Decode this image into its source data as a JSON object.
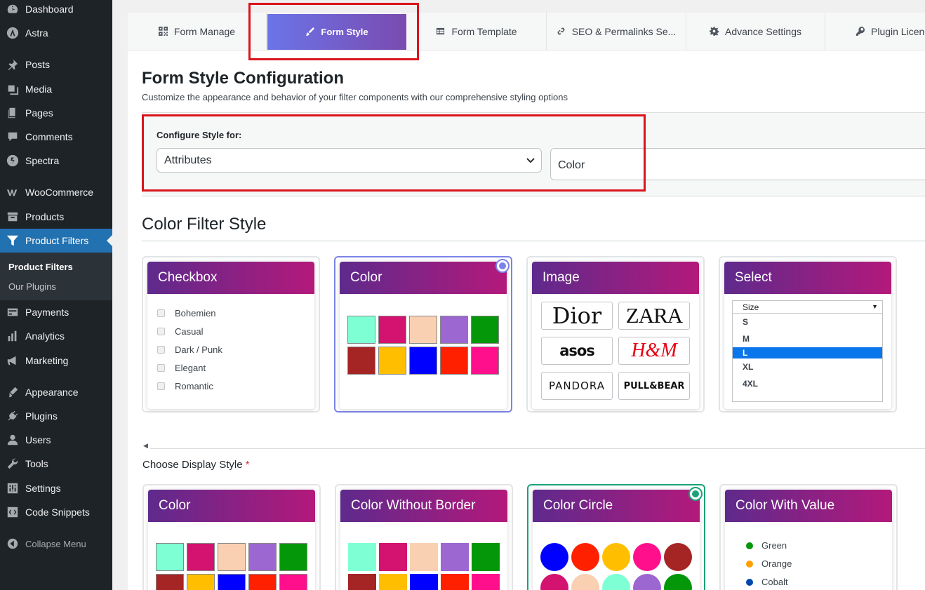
{
  "sidebar": {
    "items": [
      {
        "label": "Dashboard",
        "icon": "dashboard-icon"
      },
      {
        "label": "Astra",
        "icon": "astra-icon"
      },
      {
        "label": "Posts",
        "icon": "pin-icon"
      },
      {
        "label": "Media",
        "icon": "media-icon"
      },
      {
        "label": "Pages",
        "icon": "pages-icon"
      },
      {
        "label": "Comments",
        "icon": "comment-icon"
      },
      {
        "label": "Spectra",
        "icon": "spectra-icon"
      },
      {
        "label": "WooCommerce",
        "icon": "woo-icon"
      },
      {
        "label": "Products",
        "icon": "archive-icon"
      },
      {
        "label": "Product Filters",
        "icon": "filter-icon"
      },
      {
        "label": "Payments",
        "icon": "payments-icon"
      },
      {
        "label": "Analytics",
        "icon": "analytics-icon"
      },
      {
        "label": "Marketing",
        "icon": "megaphone-icon"
      },
      {
        "label": "Appearance",
        "icon": "brush-icon"
      },
      {
        "label": "Plugins",
        "icon": "plug-icon"
      },
      {
        "label": "Users",
        "icon": "user-icon"
      },
      {
        "label": "Tools",
        "icon": "wrench-icon"
      },
      {
        "label": "Settings",
        "icon": "settings-icon"
      },
      {
        "label": "Code Snippets",
        "icon": "code-icon"
      }
    ],
    "submenu": [
      "Product Filters",
      "Our Plugins"
    ],
    "collapse_label": "Collapse Menu"
  },
  "tabs": [
    {
      "label": "Form Manage",
      "icon": "qr-icon"
    },
    {
      "label": "Form Style",
      "icon": "brush-icon"
    },
    {
      "label": "Form Template",
      "icon": "table-icon"
    },
    {
      "label": "SEO & Permalinks Se...",
      "icon": "link-icon"
    },
    {
      "label": "Advance Settings",
      "icon": "gear-icon"
    },
    {
      "label": "Plugin Licen",
      "icon": "key-icon"
    }
  ],
  "page": {
    "title": "Form Style Configuration",
    "subtitle": "Customize the appearance and behavior of your filter components with our comprehensive styling options"
  },
  "config": {
    "label": "Configure Style for:",
    "select_type": "Attributes",
    "select_attribute": "Color"
  },
  "filter_style": {
    "title": "Color Filter Style",
    "cards": [
      {
        "title": "Checkbox",
        "items": [
          "Bohemien",
          "Casual",
          "Dark / Punk",
          "Elegant",
          "Romantic"
        ]
      },
      {
        "title": "Color"
      },
      {
        "title": "Image",
        "brands": [
          "Dior",
          "ZARA",
          "asos",
          "H&M",
          "PANDORA",
          "PULL&BEAR"
        ]
      },
      {
        "title": "Select",
        "placeholder": "Size",
        "options": [
          "S",
          "M",
          "L",
          "XL",
          "4XL"
        ]
      }
    ],
    "swatches": [
      "#7fffd4",
      "#d4126f",
      "#fad0b2",
      "#9d67d1",
      "#04970a",
      "#a52424",
      "#ffbf00",
      "#0000ff",
      "#ff2000",
      "#ff0f8b"
    ]
  },
  "display_style": {
    "label": "Choose Display Style",
    "required_mark": "*",
    "cards": [
      {
        "title": "Color"
      },
      {
        "title": "Color Without Border"
      },
      {
        "title": "Color Circle"
      },
      {
        "title": "Color With Value",
        "items": [
          {
            "label": "Green",
            "color": "#04970a"
          },
          {
            "label": "Orange",
            "color": "#ffa000"
          },
          {
            "label": "Cobalt",
            "color": "#0047ab"
          }
        ]
      }
    ],
    "circles": [
      "#0000ff",
      "#ff2000",
      "#ffbf00",
      "#ff0f8b",
      "#a52424",
      "#d4126f",
      "#fad0b2",
      "#7fffd4",
      "#9d67d1",
      "#04970a"
    ]
  },
  "colors": {
    "sidebar_bg": "#1d2327",
    "active_blue": "#2271b1",
    "highlight_red": "#d9141c",
    "card_gradient_start": "#5e2a8c",
    "card_gradient_end": "#b3197b"
  }
}
